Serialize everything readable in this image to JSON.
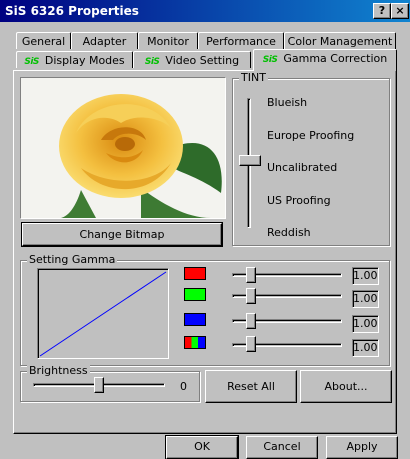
{
  "window": {
    "title": "SiS 6326 Properties",
    "help_glyph": "?",
    "close_glyph": "×"
  },
  "tabs_row1": [
    {
      "label": "General"
    },
    {
      "label": "Adapter"
    },
    {
      "label": "Monitor"
    },
    {
      "label": "Performance"
    },
    {
      "label": "Color Management"
    }
  ],
  "tabs_row2": [
    {
      "label": "Display Modes",
      "logo": "SiS"
    },
    {
      "label": "Video Setting",
      "logo": "SiS"
    },
    {
      "label": "Gamma Correction",
      "logo": "SiS",
      "active": true
    }
  ],
  "preview": {
    "image": "yellow-rose-icon",
    "change_bitmap_label": "Change Bitmap"
  },
  "tint": {
    "title": "TINT",
    "labels": [
      "Blueish",
      "Europe Proofing",
      "Uncalibrated",
      "US Proofing",
      "Reddish"
    ],
    "selected_index": 2
  },
  "gamma": {
    "title": "Setting Gamma",
    "channels": [
      {
        "color": "#ff0000",
        "value": "1.00"
      },
      {
        "color": "#00ff00",
        "value": "1.00"
      },
      {
        "color": "#0000ff",
        "value": "1.00"
      },
      {
        "color": "rgb",
        "value": "1.00"
      }
    ],
    "curve_color": "#0000ff"
  },
  "brightness": {
    "title": "Brightness",
    "value": "0"
  },
  "buttons": {
    "reset_all": "Reset All",
    "about": "About...",
    "ok": "OK",
    "cancel": "Cancel",
    "apply": "Apply"
  }
}
